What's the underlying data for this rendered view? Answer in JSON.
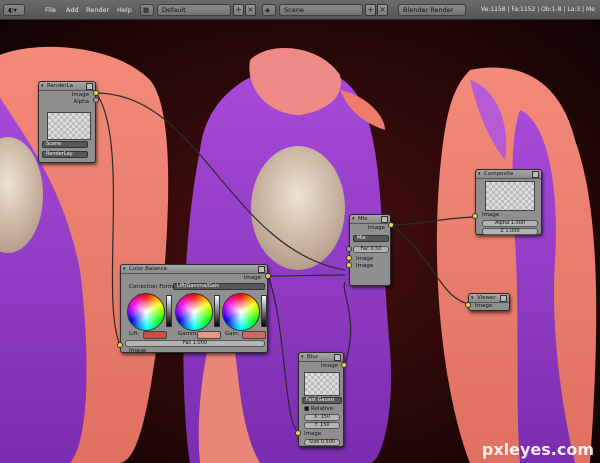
{
  "topbar": {
    "menu": [
      "File",
      "Add",
      "Render",
      "Help"
    ],
    "screen_layout": "Default",
    "scene": "Scene",
    "engine": "Blender Render",
    "stats": "Ve:1158 | Fa:1152 | Ob:1-8 | La:3 | Me"
  },
  "nodes": {
    "render_layers": {
      "title": "RenderLa",
      "out_image": "Image",
      "out_alpha": "Alpha",
      "scene": "Scene",
      "layer": "RenderLay"
    },
    "color_balance": {
      "title": "Color Balance",
      "out_image": "Image",
      "correction_label": "Correction Form",
      "correction_value": "Lift/Gamma/Gain",
      "lift": "Lift:",
      "gamma": "Gamma:",
      "gain": "Gain:",
      "fac": "Fac 1.000",
      "in_image": "Image"
    },
    "mix": {
      "title": "Mix",
      "out_image": "Image",
      "mode": "Mix",
      "fac": "Fac 0.50",
      "in_image1": "Image",
      "in_image2": "Image"
    },
    "composite": {
      "title": "Composite",
      "in_image": "Image",
      "alpha": "Alpha 1.000",
      "z": "Z 1.000"
    },
    "viewer": {
      "title": "Viewer",
      "in_image": "Image"
    },
    "blur": {
      "title": "Blur",
      "out_image": "Image",
      "filter": "Fast Gaussi",
      "relative": "Relative",
      "x": "X: 150",
      "y": "Y: 150",
      "in_image": "Image",
      "size": "Size 0.500"
    }
  },
  "watermark": "pxleyes.com",
  "colors": {
    "hair_pink": "#f08272",
    "hair_purple": "#9a3fd0",
    "background": "#2a0808",
    "node_bg": "#8f8f8f",
    "socket": "#e8d24a"
  }
}
